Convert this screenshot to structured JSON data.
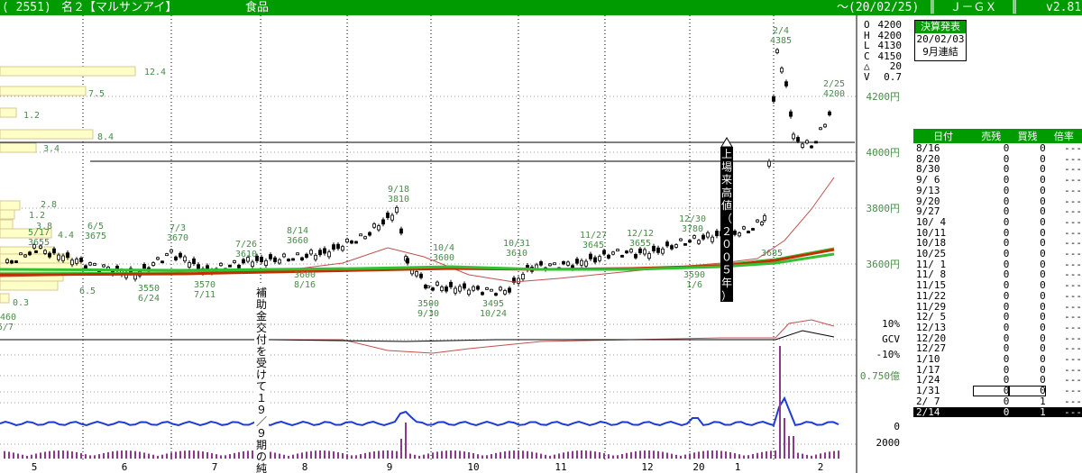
{
  "title_bar": {
    "code": "( 2551)",
    "market": "名２",
    "name": "【マルサンアイ】",
    "sector": "食品",
    "period": "～(20/02/25)",
    "filter": "║  Ｊ－ＧＸ  ║",
    "version": "v2.81"
  },
  "ohlc_panel": {
    "rows": [
      {
        "label": "O",
        "value": "4200"
      },
      {
        "label": "H",
        "value": "4200"
      },
      {
        "label": "L",
        "value": "4130"
      },
      {
        "label": "C",
        "value": "4150"
      },
      {
        "label": "△",
        "value": "20"
      },
      {
        "label": "V",
        "value": "0.7"
      }
    ]
  },
  "kessan": {
    "header": "決算発表",
    "date": "20/02/03",
    "type": "9月連結"
  },
  "price_labels": [
    "4200円",
    "4000円",
    "3800円",
    "3600円"
  ],
  "oscillator_labels": [
    "10%",
    "GCV",
    "-10%"
  ],
  "volume_labels": [
    "0.750億",
    "0",
    "2000"
  ],
  "month_labels": [
    "5",
    "6",
    "7",
    "8",
    "9",
    "10",
    "11",
    "12",
    "20",
    "1",
    "2"
  ],
  "annotations": {
    "vertical_note": "補助金交付を受けて１９／９期の純",
    "high_note": "上場来高値（２００５年）"
  },
  "price_callouts": [
    {
      "date": "2/4",
      "price": "4385"
    },
    {
      "date": "2/25",
      "price": "4200"
    },
    {
      "date": "9/18",
      "price": "3810"
    },
    {
      "date": "12/30",
      "price": "3780"
    },
    {
      "date": "6/5",
      "price": "3675"
    },
    {
      "date": "7/3",
      "price": "3670"
    },
    {
      "date": "5/17",
      "price": "3655"
    },
    {
      "date": "8/14",
      "price": "3660"
    },
    {
      "date": "11/27",
      "price": "3645"
    },
    {
      "date": "12/12",
      "price": "3655"
    },
    {
      "date": "10/31",
      "price": "3610"
    },
    {
      "date": "10/4",
      "price": "3600"
    },
    {
      "date": "7/26",
      "price": "3610"
    },
    {
      "date": "8/16",
      "price": "3600"
    },
    {
      "date": "6/24",
      "price": "3550"
    },
    {
      "date": "7/11",
      "price": "3570"
    },
    {
      "date": "9/30",
      "price": "3500"
    },
    {
      "date": "10/24",
      "price": "3495"
    },
    {
      "date": "1/6",
      "price": "3590"
    },
    {
      "date": "",
      "price": "3685"
    },
    {
      "date": "5/7",
      "price": "3460"
    }
  ],
  "volume_profile_labels": [
    "12.4",
    "7.5",
    "1.2",
    "8.4",
    "3.4",
    "2.8",
    "1.2",
    "3.8",
    "4.4",
    "6.5",
    "0.3"
  ],
  "margin_table": {
    "headers": [
      "日付",
      "売残",
      "買残",
      "倍率"
    ],
    "rows": [
      [
        "8/16",
        "0",
        "0",
        "---"
      ],
      [
        "8/20",
        "0",
        "0",
        "---"
      ],
      [
        "8/30",
        "0",
        "0",
        "---"
      ],
      [
        "9/ 6",
        "0",
        "0",
        "---"
      ],
      [
        "9/13",
        "0",
        "0",
        "---"
      ],
      [
        "9/20",
        "0",
        "0",
        "---"
      ],
      [
        "9/27",
        "0",
        "0",
        "---"
      ],
      [
        "10/ 4",
        "0",
        "0",
        "---"
      ],
      [
        "10/11",
        "0",
        "0",
        "---"
      ],
      [
        "10/18",
        "0",
        "0",
        "---"
      ],
      [
        "10/25",
        "0",
        "0",
        "---"
      ],
      [
        "11/ 1",
        "0",
        "0",
        "---"
      ],
      [
        "11/ 8",
        "0",
        "0",
        "---"
      ],
      [
        "11/15",
        "0",
        "0",
        "---"
      ],
      [
        "11/22",
        "0",
        "0",
        "---"
      ],
      [
        "11/29",
        "0",
        "0",
        "---"
      ],
      [
        "12/ 5",
        "0",
        "0",
        "---"
      ],
      [
        "12/13",
        "0",
        "0",
        "---"
      ],
      [
        "12/20",
        "0",
        "0",
        "---"
      ],
      [
        "12/27",
        "0",
        "0",
        "---"
      ],
      [
        "1/10",
        "0",
        "0",
        "---"
      ],
      [
        "1/17",
        "0",
        "0",
        "---"
      ],
      [
        "1/24",
        "0",
        "0",
        "---"
      ],
      [
        "1/31",
        "0",
        "0",
        "---"
      ],
      [
        "2/ 7",
        "0",
        "1",
        "---"
      ],
      [
        "2/14",
        "0",
        "1",
        "---"
      ]
    ]
  },
  "colors": {
    "bar": "#009b00",
    "label_green": "#4a8a4a",
    "ma_short": "#c05050",
    "ma_mid": "#c03000",
    "ma_long": "#33c033",
    "volume_line": "#1c3cd6",
    "volume_bar": "#8b3a8b",
    "profile_fill": "#ffffc8",
    "profile_edge": "#d8c890"
  }
}
